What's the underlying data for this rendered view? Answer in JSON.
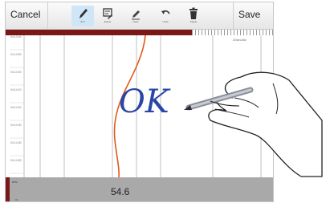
{
  "toolbar": {
    "cancel_label": "Cancel",
    "save_label": "Save",
    "tools": [
      {
        "label": "Pen",
        "icon": "pen-icon",
        "active": true
      },
      {
        "label": "Eraser",
        "icon": "eraser-tool-icon",
        "active": false
      },
      {
        "label": "Clear",
        "icon": "pencil-icon",
        "active": false
      },
      {
        "label": "Undo",
        "icon": "undo-icon",
        "active": false
      },
      {
        "label": "Delete",
        "icon": "trash-icon",
        "active": false
      }
    ]
  },
  "chart": {
    "scale_label": "20sec/div",
    "depths": [
      "04:13:40",
      "04:13:50",
      "04:14:00",
      "04:14:10",
      "04:14:20",
      "04:14:30",
      "04:14:40",
      "04:14:50"
    ]
  },
  "annotation": {
    "text": "OK"
  },
  "footer": {
    "label": "RPM",
    "value": "54.6",
    "small": "01"
  },
  "colors": {
    "accent_red": "#7b1717",
    "curve": "#e05a1a",
    "ink": "#2a45a8",
    "footer_bg": "#a9a9a9"
  }
}
